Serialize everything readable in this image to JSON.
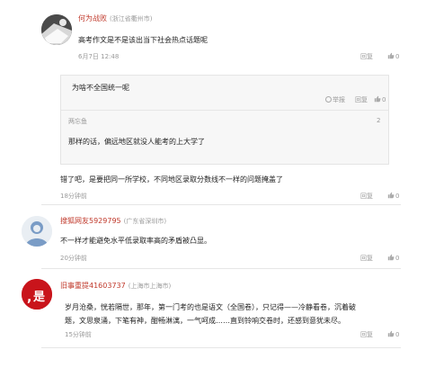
{
  "comment1": {
    "username": "何为战败",
    "location": "(浙江省衢州市)",
    "text": "高考作文是不是该出当下社会热点话题呢",
    "time": "6月7日 12:48",
    "reply_label": "回复",
    "likes": "0"
  },
  "nested": {
    "prev_text": "为啥不全国统一呢",
    "prev_report": "举报",
    "prev_reply": "回复",
    "prev_likes": "0",
    "username": "两忘鱼",
    "floor": "2",
    "text": "那样的话，偏远地区就没人能考的上大学了"
  },
  "comment2": {
    "text": "错了吧，是要把同一所学校，不同地区录取分数线不一样的问题掩盖了",
    "time": "18分钟前",
    "reply_label": "回复",
    "likes": "0"
  },
  "comment3": {
    "username": "搜狐网友5929795",
    "location": "(广东省深圳市)",
    "text": "不一样才能避免水平低录取率高的矛盾被凸显。",
    "time": "20分钟前",
    "reply_label": "回复",
    "likes": "0"
  },
  "comment4": {
    "username": "旧事重提41603737",
    "location": "(上海市上海市)",
    "avatar_text": "是",
    "text_line1": "岁月沧桑，恍若隔世，那年，第一门考的也是语文（全国卷），只记得——冷静看卷，沉着破",
    "text_line2": "题，文思泉涌，下笔有神，酣畅淋漓，一气呵成……直到铃响交卷时，还感到意犹未尽。",
    "time": "15分钟前",
    "reply_label": "回复",
    "likes": "0"
  },
  "colors": {
    "username": "#c0392b",
    "muted": "#999999",
    "quote_bg": "#f7f7f7"
  }
}
